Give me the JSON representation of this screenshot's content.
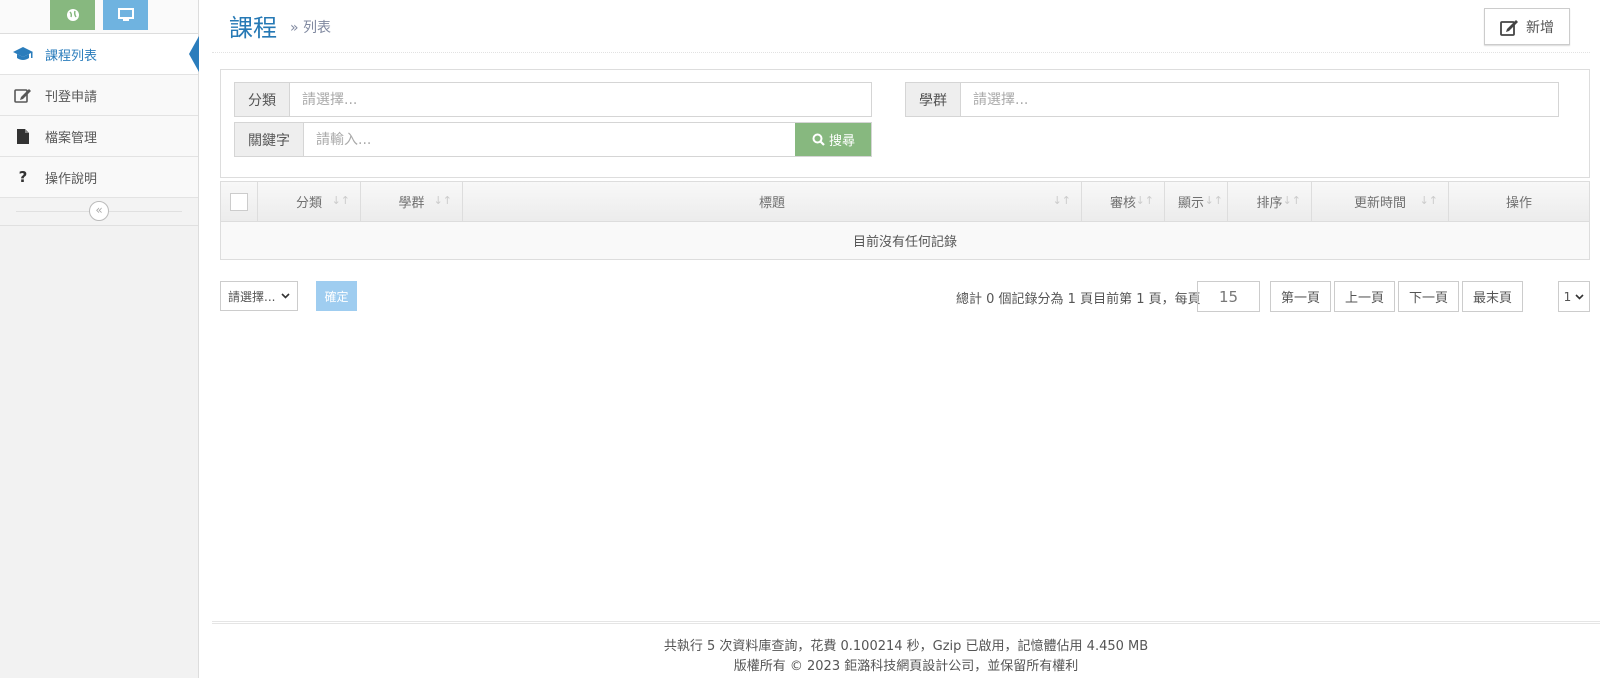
{
  "sidebar": {
    "items": [
      {
        "label": "課程列表"
      },
      {
        "label": "刊登申請"
      },
      {
        "label": "檔案管理"
      },
      {
        "label": "操作說明"
      }
    ]
  },
  "header": {
    "title": "課程",
    "subtitle": "» 列表",
    "add_label": "新增"
  },
  "filters": {
    "category_label": "分類",
    "category_placeholder": "請選擇...",
    "group_label": "學群",
    "group_placeholder": "請選擇...",
    "keyword_label": "關鍵字",
    "keyword_placeholder": "請輸入...",
    "search_label": "搜尋"
  },
  "table": {
    "columns": [
      "分類",
      "學群",
      "標題",
      "審核",
      "顯示",
      "排序",
      "更新時間",
      "操作"
    ],
    "empty_text": "目前沒有任何記錄"
  },
  "pagination": {
    "bulk_select": "請選擇...",
    "confirm_label": "確定",
    "summary": "總計 0 個記錄分為 1 頁目前第 1 頁，每頁",
    "per_page": "15",
    "first": "第一頁",
    "prev": "上一頁",
    "next": "下一頁",
    "last": "最末頁",
    "page_select": "1"
  },
  "footer": {
    "stats": "共執行 5 次資料庫查詢，花費 0.100214 秒，Gzip 已啟用，記憶體佔用 4.450 MB",
    "copyright": "版權所有 © 2023 鉅潞科技網頁設計公司，並保留所有權利"
  },
  "colors": {
    "accent": "#2679b5",
    "success": "#87b87f",
    "info": "#6fb3e0"
  }
}
